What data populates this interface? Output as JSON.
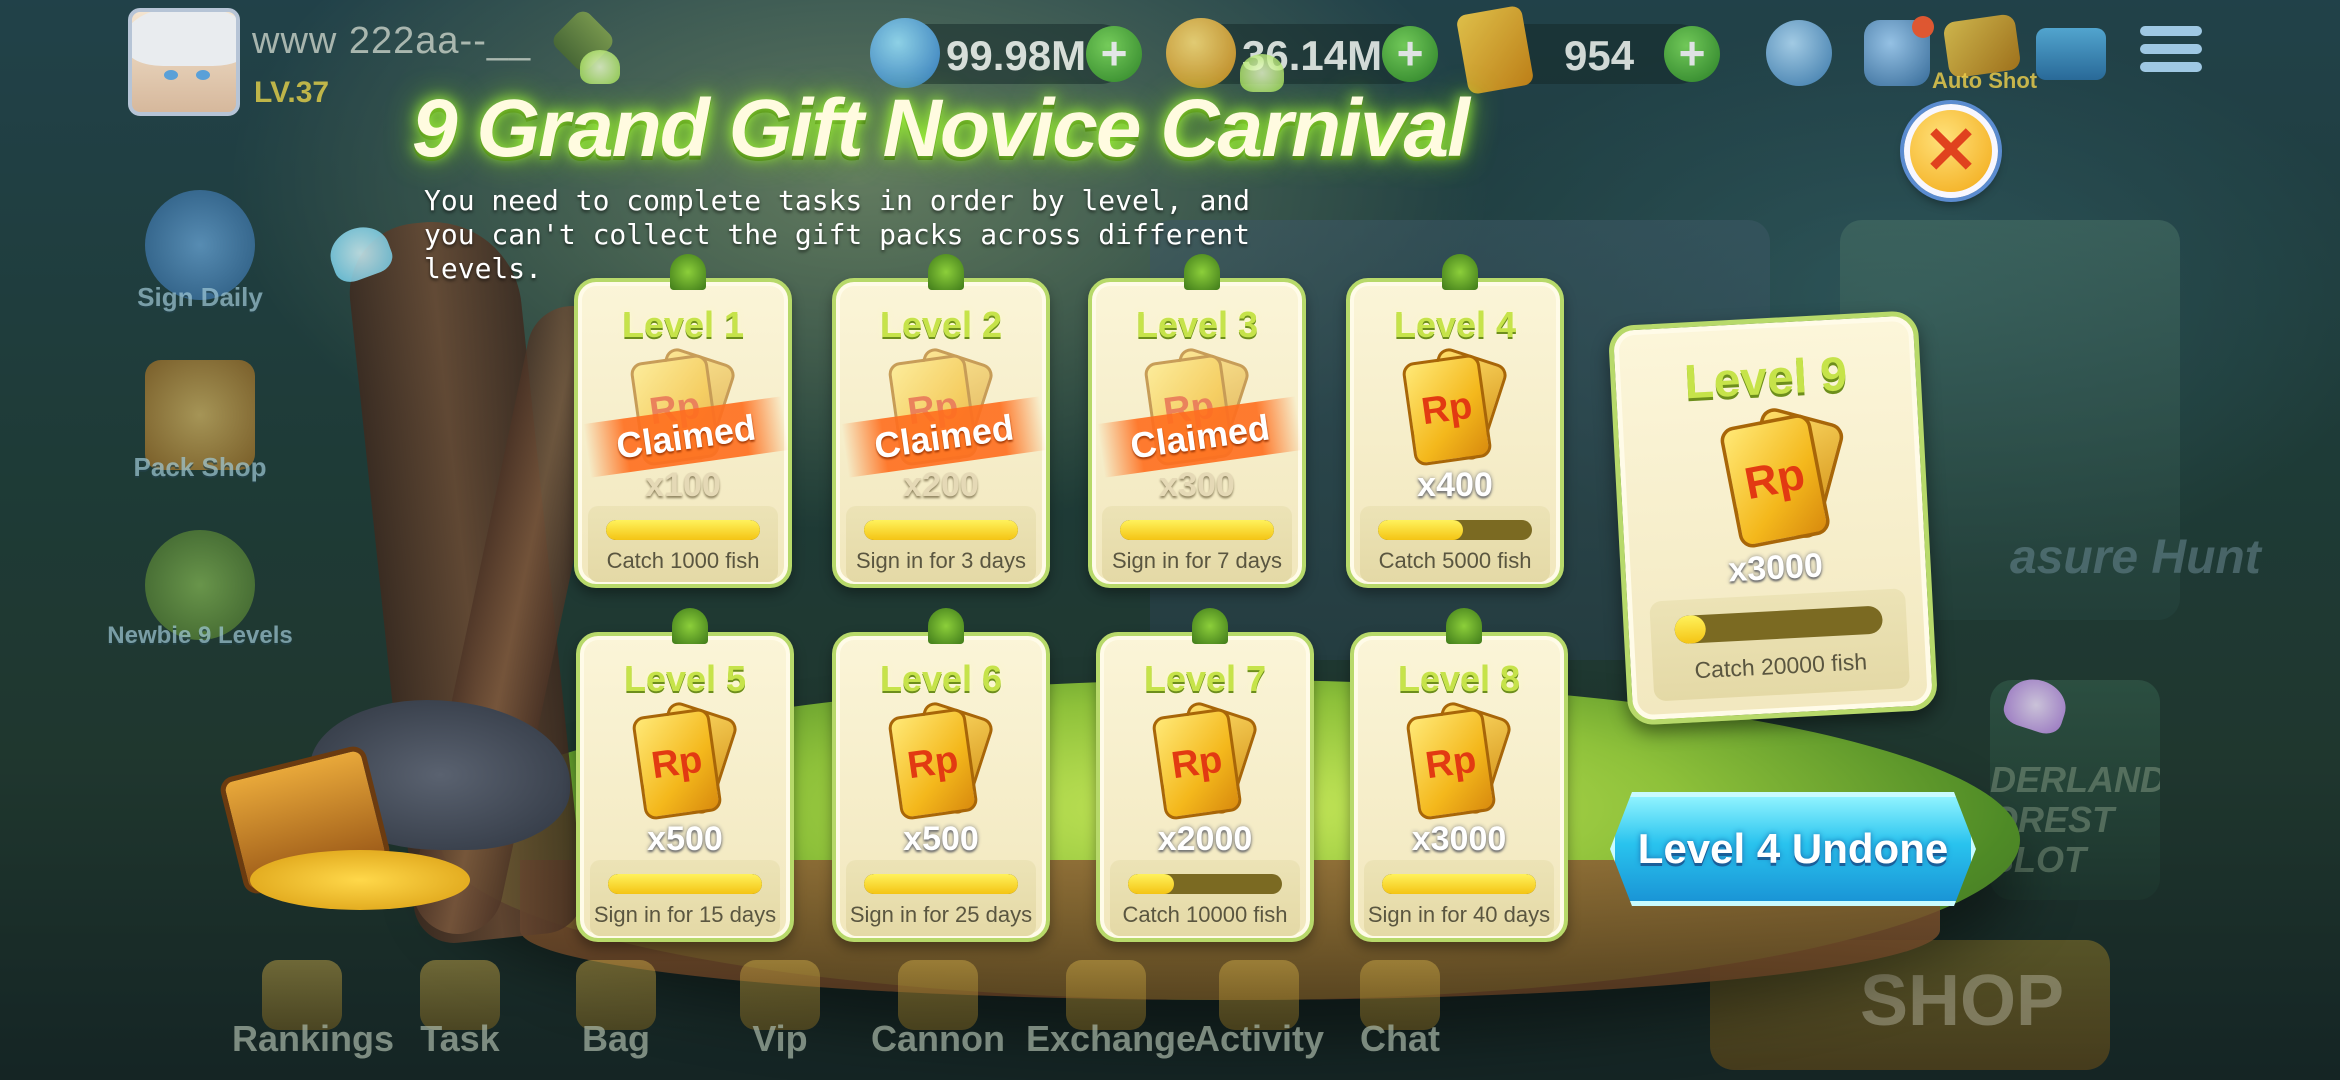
{
  "player": {
    "name": "www  222aa--__",
    "level": "LV.37"
  },
  "currencies": [
    {
      "icon": "diamond-icon",
      "value": "99.98M"
    },
    {
      "icon": "coin-icon",
      "value": "36.14M"
    },
    {
      "icon": "rp-ticket-icon",
      "value": "954"
    }
  ],
  "hud": {
    "auto_shot_label": "Auto Shot"
  },
  "side_menu": [
    {
      "label": "Sign Daily"
    },
    {
      "label": "Pack Shop"
    },
    {
      "label": "Newbie 9 Levels"
    }
  ],
  "bottom_nav": [
    {
      "label": "Rankings"
    },
    {
      "label": "Task"
    },
    {
      "label": "Bag"
    },
    {
      "label": "Vip"
    },
    {
      "label": "Cannon"
    },
    {
      "label": "Exchange"
    },
    {
      "label": "Activity"
    },
    {
      "label": "Chat"
    }
  ],
  "background": {
    "treasure_hunt": "asure Hunt",
    "wonderland": "DERLAND OREST SLOT",
    "shop": "SHOP"
  },
  "popup": {
    "title": "9 Grand Gift Novice Carnival",
    "description": "You need to complete tasks in order by level, and you can't collect the gift packs across different levels.",
    "claimed_label": "Claimed",
    "status_button": "Level 4 Undone",
    "levels": [
      {
        "label": "Level 1",
        "quantity": "x100",
        "task": "Catch 1000 fish",
        "claimed": true,
        "progress": 1.0
      },
      {
        "label": "Level 2",
        "quantity": "x200",
        "task": "Sign in for 3 days",
        "claimed": true,
        "progress": 1.0
      },
      {
        "label": "Level 3",
        "quantity": "x300",
        "task": "Sign in for 7 days",
        "claimed": true,
        "progress": 1.0
      },
      {
        "label": "Level 4",
        "quantity": "x400",
        "task": "Catch 5000 fish",
        "claimed": false,
        "progress": 0.55
      },
      {
        "label": "Level 5",
        "quantity": "x500",
        "task": "Sign in for 15 days",
        "claimed": false,
        "progress": 1.0
      },
      {
        "label": "Level 6",
        "quantity": "x500",
        "task": "Sign in for 25 days",
        "claimed": false,
        "progress": 1.0
      },
      {
        "label": "Level 7",
        "quantity": "x2000",
        "task": "Catch 10000 fish",
        "claimed": false,
        "progress": 0.3
      },
      {
        "label": "Level 8",
        "quantity": "x3000",
        "task": "Sign in for 40 days",
        "claimed": false,
        "progress": 1.0
      },
      {
        "label": "Level 9",
        "quantity": "x3000",
        "task": "Catch 20000 fish",
        "claimed": false,
        "progress": 0.15
      }
    ],
    "reward_icon_text": "Rp"
  },
  "colors": {
    "level_title": "#c6e34a",
    "progress_fill": "#f4c414",
    "claimed_band": "#ff6e1e",
    "status_button": "#29c3ee"
  }
}
